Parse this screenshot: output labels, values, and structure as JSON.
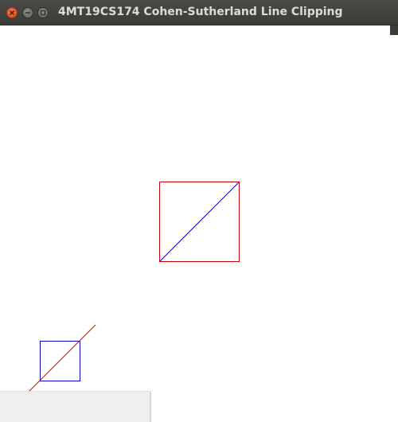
{
  "window": {
    "title": "4MT19CS174 Cohen-Sutherland Line Clipping",
    "buttons": {
      "close": "close-icon",
      "minimize": "minimize-icon",
      "maximize": "maximize-icon"
    }
  },
  "colors": {
    "titlebar": "#3c3b37",
    "title_text": "#dfdbd2",
    "window_bg": "#ffffff",
    "clip_window_before": "#0000cc",
    "line_before": "#cc0000",
    "clip_window_after": "#cc0000",
    "line_after": "#0000cc",
    "panel_bg": "#f0efed"
  }
}
